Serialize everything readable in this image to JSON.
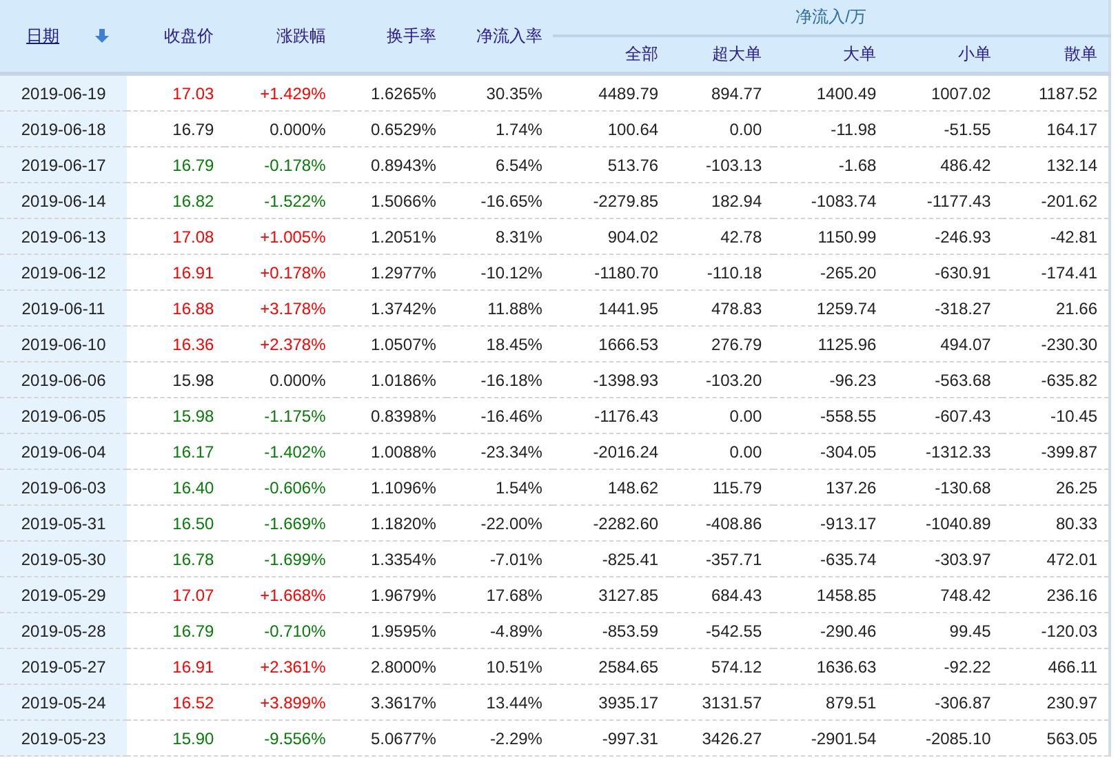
{
  "table": {
    "columns": [
      {
        "label": "日期",
        "kind": "sort",
        "sorted": true
      },
      {
        "label": "收盘价",
        "kind": "plain"
      },
      {
        "label": "涨跌幅",
        "kind": "plain"
      },
      {
        "label": "换手率",
        "kind": "plain"
      },
      {
        "label": "净流入率",
        "kind": "plain"
      }
    ],
    "group": {
      "label": "净流入/万",
      "columns": [
        "全部",
        "超大单",
        "大单",
        "小单",
        "散单"
      ]
    },
    "rows": [
      {
        "date": "2019-06-19",
        "color": "#ff0000",
        "close": "17.03",
        "change": "+1.429%",
        "turnover": "1.6265%",
        "net_rate": "30.35%",
        "net": [
          "4489.79",
          "894.77",
          "1400.49",
          "1007.02",
          "1187.52"
        ]
      },
      {
        "date": "2019-06-18",
        "color": "#222222",
        "close": "16.79",
        "change": "0.000%",
        "turnover": "0.6529%",
        "net_rate": "1.74%",
        "net": [
          "100.64",
          "0.00",
          "-11.98",
          "-51.55",
          "164.17"
        ]
      },
      {
        "date": "2019-06-17",
        "color": "#077b07",
        "close": "16.79",
        "change": "-0.178%",
        "turnover": "0.8943%",
        "net_rate": "6.54%",
        "net": [
          "513.76",
          "-103.13",
          "-1.68",
          "486.42",
          "132.14"
        ]
      },
      {
        "date": "2019-06-14",
        "color": "#077b07",
        "close": "16.82",
        "change": "-1.522%",
        "turnover": "1.5066%",
        "net_rate": "-16.65%",
        "net": [
          "-2279.85",
          "182.94",
          "-1083.74",
          "-1177.43",
          "-201.62"
        ]
      },
      {
        "date": "2019-06-13",
        "color": "#ff0000",
        "close": "17.08",
        "change": "+1.005%",
        "turnover": "1.2051%",
        "net_rate": "8.31%",
        "net": [
          "904.02",
          "42.78",
          "1150.99",
          "-246.93",
          "-42.81"
        ]
      },
      {
        "date": "2019-06-12",
        "color": "#ff0000",
        "close": "16.91",
        "change": "+0.178%",
        "turnover": "1.2977%",
        "net_rate": "-10.12%",
        "net": [
          "-1180.70",
          "-110.18",
          "-265.20",
          "-630.91",
          "-174.41"
        ]
      },
      {
        "date": "2019-06-11",
        "color": "#ff0000",
        "close": "16.88",
        "change": "+3.178%",
        "turnover": "1.3742%",
        "net_rate": "11.88%",
        "net": [
          "1441.95",
          "478.83",
          "1259.74",
          "-318.27",
          "21.66"
        ]
      },
      {
        "date": "2019-06-10",
        "color": "#ff0000",
        "close": "16.36",
        "change": "+2.378%",
        "turnover": "1.0507%",
        "net_rate": "18.45%",
        "net": [
          "1666.53",
          "276.79",
          "1125.96",
          "494.07",
          "-230.30"
        ]
      },
      {
        "date": "2019-06-06",
        "color": "#222222",
        "close": "15.98",
        "change": "0.000%",
        "turnover": "1.0186%",
        "net_rate": "-16.18%",
        "net": [
          "-1398.93",
          "-103.20",
          "-96.23",
          "-563.68",
          "-635.82"
        ]
      },
      {
        "date": "2019-06-05",
        "color": "#077b07",
        "close": "15.98",
        "change": "-1.175%",
        "turnover": "0.8398%",
        "net_rate": "-16.46%",
        "net": [
          "-1176.43",
          "0.00",
          "-558.55",
          "-607.43",
          "-10.45"
        ]
      },
      {
        "date": "2019-06-04",
        "color": "#077b07",
        "close": "16.17",
        "change": "-1.402%",
        "turnover": "1.0088%",
        "net_rate": "-23.34%",
        "net": [
          "-2016.24",
          "0.00",
          "-304.05",
          "-1312.33",
          "-399.87"
        ]
      },
      {
        "date": "2019-06-03",
        "color": "#077b07",
        "close": "16.40",
        "change": "-0.606%",
        "turnover": "1.1096%",
        "net_rate": "1.54%",
        "net": [
          "148.62",
          "115.79",
          "137.26",
          "-130.68",
          "26.25"
        ]
      },
      {
        "date": "2019-05-31",
        "color": "#077b07",
        "close": "16.50",
        "change": "-1.669%",
        "turnover": "1.1820%",
        "net_rate": "-22.00%",
        "net": [
          "-2282.60",
          "-408.86",
          "-913.17",
          "-1040.89",
          "80.33"
        ]
      },
      {
        "date": "2019-05-30",
        "color": "#077b07",
        "close": "16.78",
        "change": "-1.699%",
        "turnover": "1.3354%",
        "net_rate": "-7.01%",
        "net": [
          "-825.41",
          "-357.71",
          "-635.74",
          "-303.97",
          "472.01"
        ]
      },
      {
        "date": "2019-05-29",
        "color": "#ff0000",
        "close": "17.07",
        "change": "+1.668%",
        "turnover": "1.9679%",
        "net_rate": "17.68%",
        "net": [
          "3127.85",
          "684.43",
          "1458.85",
          "748.42",
          "236.16"
        ]
      },
      {
        "date": "2019-05-28",
        "color": "#077b07",
        "close": "16.79",
        "change": "-0.710%",
        "turnover": "1.9595%",
        "net_rate": "-4.89%",
        "net": [
          "-853.59",
          "-542.55",
          "-290.46",
          "99.45",
          "-120.03"
        ]
      },
      {
        "date": "2019-05-27",
        "color": "#ff0000",
        "close": "16.91",
        "change": "+2.361%",
        "turnover": "2.8000%",
        "net_rate": "10.51%",
        "net": [
          "2584.65",
          "574.12",
          "1636.63",
          "-92.22",
          "466.11"
        ]
      },
      {
        "date": "2019-05-24",
        "color": "#ff0000",
        "close": "16.52",
        "change": "+3.899%",
        "turnover": "3.3617%",
        "net_rate": "13.44%",
        "net": [
          "3935.17",
          "3131.57",
          "879.51",
          "-306.87",
          "230.97"
        ]
      },
      {
        "date": "2019-05-23",
        "color": "#077b07",
        "close": "15.90",
        "change": "-9.556%",
        "turnover": "5.0677%",
        "net_rate": "-2.29%",
        "net": [
          "-997.31",
          "3426.27",
          "-2901.54",
          "-2085.10",
          "563.05"
        ]
      }
    ]
  }
}
